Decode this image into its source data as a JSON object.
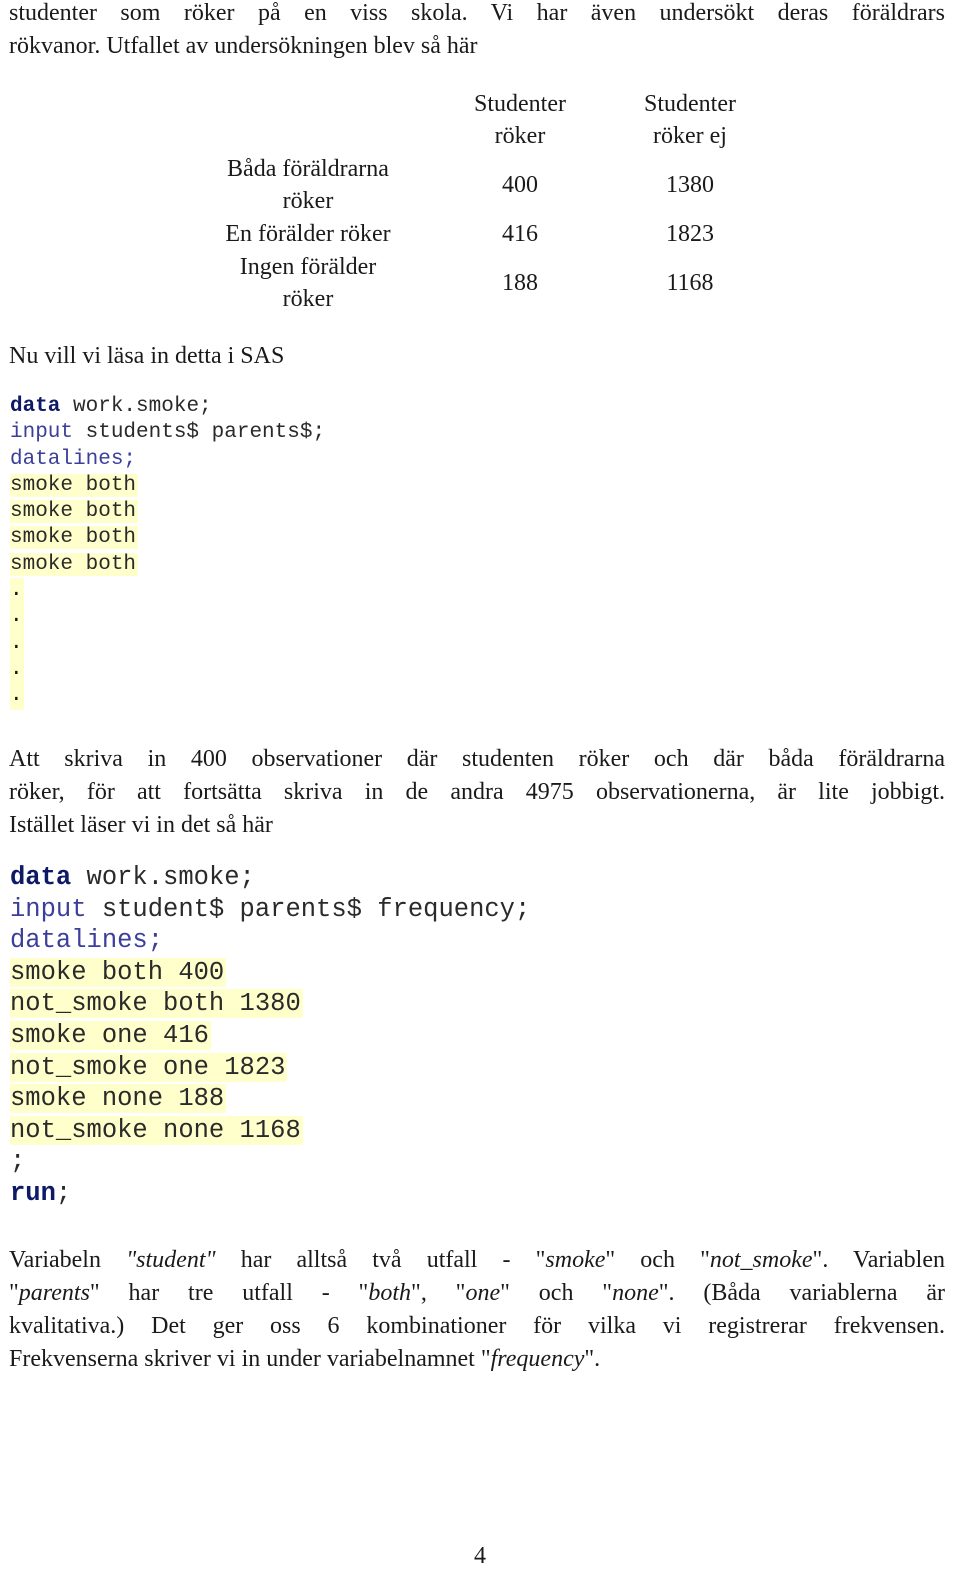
{
  "intro": {
    "line1": "studenter som röker på en viss skola.  Vi har även undersökt deras föräldrars",
    "line2": "rökvanor. Utfallet av undersökningen blev så här"
  },
  "table": {
    "col_headers": [
      {
        "line1": "Studenter",
        "line2": "röker"
      },
      {
        "line1": "Studenter",
        "line2": "röker ej"
      }
    ],
    "rows": [
      {
        "label_line1": "Båda föräldrarna",
        "label_line2": "röker",
        "values": [
          "400",
          "1380"
        ]
      },
      {
        "label_line1": "En förälder röker",
        "label_line2": "",
        "values": [
          "416",
          "1823"
        ]
      },
      {
        "label_line1": "Ingen förälder",
        "label_line2": "röker",
        "values": [
          "188",
          "1168"
        ]
      }
    ]
  },
  "sas_intro": "Nu vill vi läsa in detta i SAS",
  "code1": {
    "kw_data": "data",
    "data_rest": " work.smoke;",
    "kw_input": "input",
    "input_rest": " students$ parents$;",
    "datalines": "datalines;",
    "rows": [
      "smoke both",
      "smoke both",
      "smoke both",
      "smoke both"
    ],
    "dots": [
      ".",
      ".",
      ".",
      ".",
      "."
    ]
  },
  "para2": {
    "line1": "Att skriva in 400 observationer där studenten röker och där båda föräldrarna",
    "line2": "röker, för att fortsätta skriva in de andra 4975 observationerna, är lite jobbigt.",
    "line3": "Istället läser vi in det så här"
  },
  "code2": {
    "kw_data": "data",
    "data_rest": " work.smoke;",
    "kw_input": "input",
    "input_rest": " student$ parents$ frequency;",
    "datalines": "datalines;",
    "rows": [
      "smoke both 400",
      "not_smoke both 1380",
      "smoke one 416",
      "not_smoke one 1823",
      "smoke none 188",
      "not_smoke none 1168"
    ],
    "terminator": ";",
    "kw_run": "run",
    "run_semicolon": ";"
  },
  "para3": {
    "l1_a": "Variabeln ",
    "l1_student": "\"student\"",
    "l1_b": " har alltså två utfall - \"",
    "l1_smoke": "smoke",
    "l1_c": "\" och \"",
    "l1_notsmoke": "not_smoke",
    "l1_d": "\". Variablen",
    "l2_a": "\"",
    "l2_parents": "parents",
    "l2_b": "\" har tre utfall - \"",
    "l2_both": "both",
    "l2_c": "\", \"",
    "l2_one": "one",
    "l2_d": "\" och \"",
    "l2_none": "none",
    "l2_e": "\".  (Båda variablerna är",
    "line3": "kvalitativa.)  Det ger oss 6 kombinationer för vilka vi registrerar frekvensen.",
    "l4_a": "Frekvenserna skriver vi in under variabelnamnet \"",
    "l4_freq": "frequency",
    "l4_b": "\"."
  },
  "page_number": "4"
}
